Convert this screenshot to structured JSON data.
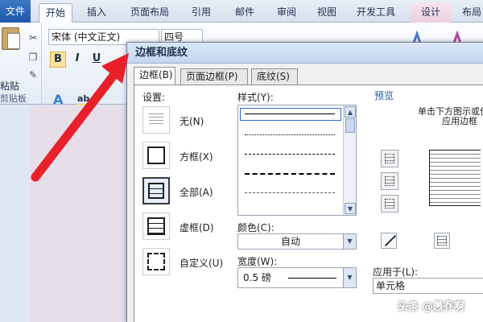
{
  "ribbon_tabs": [
    "文件",
    "开始",
    "插入",
    "页面布局",
    "引用",
    "邮件",
    "审阅",
    "视图",
    "开发工具",
    "设计",
    "布局"
  ],
  "ribbon": {
    "paste_label": "粘贴",
    "clipboard_group": "剪贴板",
    "font_name": "宋体 (中文正文)",
    "font_size": "四号",
    "bold": "B",
    "italic": "I",
    "underline": "U",
    "text_effect": "A",
    "highlight": "ab"
  },
  "dialog": {
    "title": "边框和底纹",
    "tabs": [
      "边框(B)",
      "页面边框(P)",
      "底纹(S)"
    ],
    "settings_label": "设置:",
    "settings": [
      "无(N)",
      "方框(X)",
      "全部(A)",
      "虚框(D)",
      "自定义(U)"
    ],
    "style_label": "样式(Y):",
    "color_label": "颜色(C):",
    "color_value": "自动",
    "width_label": "宽度(W):",
    "width_value": "0.5 磅",
    "preview_label": "预览",
    "preview_hint_1": "单击下方图示或使",
    "preview_hint_2": "应用边框",
    "apply_label": "应用于(L):",
    "apply_value": "单元格"
  },
  "watermark": "头条 @愚乔啊",
  "colors": {
    "accent": "#3d79c7",
    "arrow": "#e8202a"
  }
}
